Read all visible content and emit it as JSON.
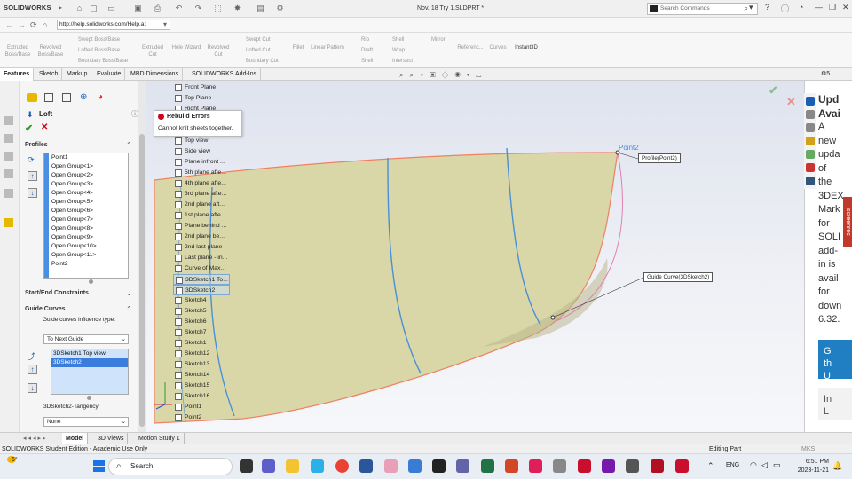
{
  "app": {
    "logo_brand": "SOLIDWORKS",
    "document_title": "Nov. 18 Try 1.SLDPRT *",
    "search_placeholder": "Search Commands",
    "url": "http://help.solidworks.com/Help.a:"
  },
  "commands": {
    "extruded_boss": "Extruded\nBoss/Base",
    "revolved_boss": "Revolved\nBoss/Base",
    "swept_boss": "Swept Boss/Base",
    "lofted_boss": "Lofted Boss/Base",
    "boundary_boss": "Boundary Boss/Base",
    "extruded_cut": "Extruded\nCut",
    "hole_wizard": "Hole Wizard",
    "revolved_cut": "Revolved\nCut",
    "swept_cut": "Swept Cut",
    "lofted_cut": "Lofted Cut",
    "boundary_cut": "Boundary Cut",
    "fillet": "Fillet",
    "linear_pattern": "Linear Pattern",
    "rib": "Rib",
    "draft": "Draft",
    "shell": "Shell",
    "wrap": "Wrap",
    "intersect": "Intersect",
    "mirror": "Mirror",
    "reference": "Referenc...",
    "curves": "Curves",
    "instant3d": "Instant3D"
  },
  "tabs": [
    "Features",
    "Sketch",
    "Markup",
    "Evaluate",
    "MBD Dimensions",
    "SOLIDWORKS Add-Ins"
  ],
  "property_manager": {
    "title": "Loft",
    "profiles_header": "Profiles",
    "profiles": [
      "Point1",
      "Open Group<1>",
      "Open Group<2>",
      "Open Group<3>",
      "Open Group<4>",
      "Open Group<5>",
      "Open Group<6>",
      "Open Group<7>",
      "Open Group<8>",
      "Open Group<9>",
      "Open Group<10>",
      "Open Group<11>",
      "Point2"
    ],
    "start_end_header": "Start/End Constraints",
    "guide_header": "Guide Curves",
    "guide_influence_label": "Guide curves influence type:",
    "guide_influence_value": "To Next Guide",
    "guide_curves": [
      "3DSketch1 Top view",
      "3DSketch2"
    ],
    "tangency_label": "3DSketch2-Tangency",
    "tangency_value": "None"
  },
  "error": {
    "title": "Rebuild Errors",
    "message": "Cannot knit sheets together."
  },
  "tree": [
    "Front Plane",
    "Top Plane",
    "Right Plane",
    "Origin",
    "Sketch1",
    "Top view",
    "Side view",
    "Plane infront ...",
    "5th plane afte...",
    "4th plane afte...",
    "3rd plane afte...",
    "2nd plane aft...",
    "1st plane afte...",
    "Plane behind ...",
    "2nd plane be...",
    "2nd last plane",
    "Last plane - in...",
    "Curve of Max...",
    "3DSketch1 To...",
    "3DSketch2",
    "Sketch4",
    "Sketch5",
    "Sketch6",
    "Sketch7",
    "Sketch1",
    "Sketch12",
    "Sketch13",
    "Sketch14",
    "Sketch15",
    "Sketch16",
    "Point1",
    "Point2"
  ],
  "viewport": {
    "point2_label": "Point2",
    "profile_callout": "Profile(Point2)",
    "guide_callout": "Guide Curve(3DSketch2)"
  },
  "task_pane": {
    "text_lines": [
      "Upd",
      "Avai",
      "A",
      "new",
      "upda",
      "of",
      "the",
      "3DEX",
      "Mark",
      "for",
      "SOLI",
      "add-",
      "in is",
      "avail",
      "for",
      "down",
      "6.32."
    ],
    "button1_lines": [
      "G",
      "th",
      "U"
    ],
    "button2_lines": [
      "In",
      "L"
    ],
    "screenrec_label": "screenrec"
  },
  "bottom_tabs": [
    "Model",
    "3D Views",
    "Motion Study 1"
  ],
  "status": {
    "left": "SOLIDWORKS Student Edition - Academic Use Only",
    "editing": "Editing Part",
    "units": "MKS"
  },
  "taskbar": {
    "weather_temp": "6°",
    "search_label": "Search",
    "lang": "ENG",
    "time": "6:51 PM",
    "date": "2023-11-21"
  },
  "colors": {
    "surface_fill": "#d9d7a8",
    "surface_edge": "#f08060",
    "guide_curve": "#4a8fd6",
    "accent_blue": "#3b7ddd",
    "error_red": "#d0021b"
  }
}
